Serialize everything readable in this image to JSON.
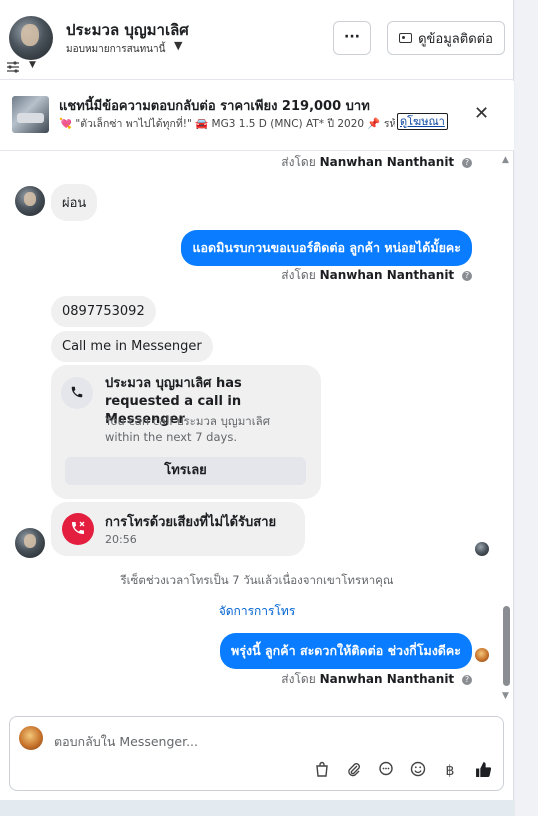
{
  "header": {
    "contact_name": "ประมวล บุญมาเลิศ",
    "assign_label": "มอบหมายการสนทนานี้",
    "more_label": "···",
    "info_button_label": "ดูข้อมูลติดต่อ"
  },
  "ad": {
    "title": "แชทนี้มีข้อความตอบกลับต่อ ราคาเพียง 219,000 บาท",
    "subtitle": "💘 \"ตัวเล็กซ่า พาไปได้ทุกที่!\" 🚘 MG3 1.5 D (MNC) AT* ปี 2020 📌 รห้...",
    "link_label": "ดูโฆษณา",
    "close_label": "✕"
  },
  "messages": {
    "sent_by_prefix": "ส่งโดย",
    "sender_name": "Nanwhan Nanthanit",
    "info_mark": "?",
    "customer_1": "ผ่อน",
    "agent_1": "แอดมินรบกวนขอเบอร์ติดต่อ ลูกค้า หน่อยได้มั้ยคะ",
    "customer_phone": "0897753092",
    "customer_call_me": "Call me in Messenger",
    "call_request_title": "ประมวล บุญมาเลิศ has requested a call in Messenger",
    "call_request_sub": "You can call ประมวล บุญมาเลิศ within the next 7 days.",
    "call_now_label": "โทรเลย",
    "missed_call_title": "การโทรด้วยเสียงที่ไม่ได้รับสาย",
    "missed_call_time": "20:56",
    "reset_note": "รีเซ็ตช่วงเวลาโทรเป็น 7 วันแล้วเนื่องจากเขาโทรหาคุณ",
    "manage_calls_label": "จัดการการโทร",
    "agent_2": "พรุ่งนี้ ลูกค้า สะดวกให้ติดต่อ ช่วงกี่โมงดีคะ"
  },
  "composer": {
    "placeholder": "ตอบกลับใน Messenger..."
  },
  "icons": {
    "adjust": "sliders-icon",
    "phone": "phone-icon",
    "missed": "missed-call-icon",
    "tools": [
      "bag-icon",
      "attachment-icon",
      "chat-bubble-icon",
      "emoji-icon",
      "baht-icon",
      "thumbs-up-icon"
    ]
  },
  "colors": {
    "accent": "#0a7cff",
    "missed": "#e41e3f",
    "link": "#0064d1"
  }
}
